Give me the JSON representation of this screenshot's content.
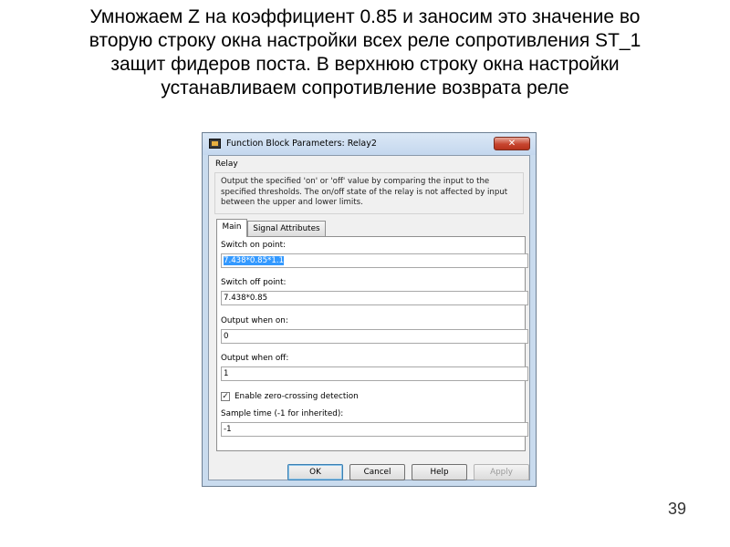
{
  "slide": {
    "heading_lines": [
      "Умножаем Z на коэффициент 0.85 и заносим это значение во",
      "вторую строку окна настройки всех реле сопротивления ST_1",
      "защит фидеров поста. В верхнюю строку окна настройки",
      "устанавливаем сопротивление возврата реле"
    ],
    "page_number": "39"
  },
  "dialog": {
    "title": "Function Block Parameters: Relay2",
    "close_label": "✕",
    "block_name": "Relay",
    "description": "Output the specified 'on' or 'off' value by comparing the input to the specified thresholds.  The on/off state of the relay is not affected by input between the upper and lower limits.",
    "tabs": [
      "Main",
      "Signal Attributes"
    ],
    "fields": [
      {
        "label": "Switch on point:",
        "value": "7.438*0.85*1.1"
      },
      {
        "label": "Switch off point:",
        "value": "7.438*0.85"
      },
      {
        "label": "Output when on:",
        "value": "0"
      },
      {
        "label": "Output when off:",
        "value": "1"
      },
      {
        "label": "Sample time (-1 for inherited):",
        "value": "-1"
      }
    ],
    "checkbox": {
      "label": "Enable zero-crossing detection",
      "checked": true,
      "mark": "✓"
    },
    "buttons": {
      "ok": "OK",
      "cancel": "Cancel",
      "help": "Help",
      "apply": "Apply"
    }
  },
  "icons": {
    "app": "simulink-block-icon",
    "close": "close-icon",
    "check": "checkmark-icon"
  }
}
